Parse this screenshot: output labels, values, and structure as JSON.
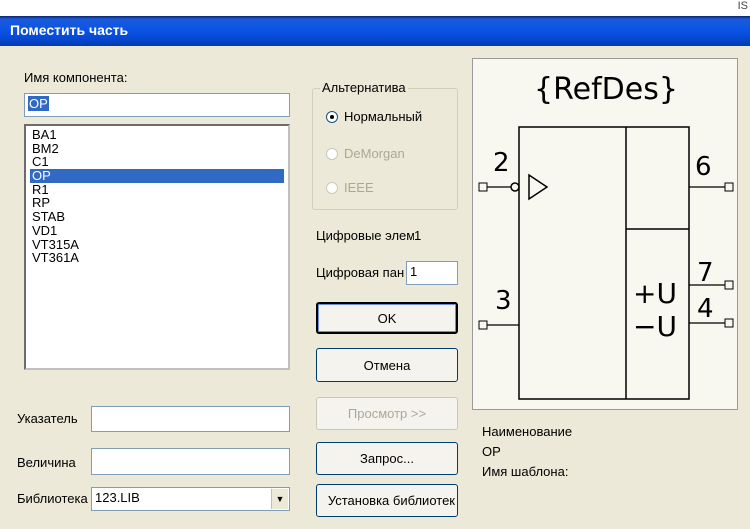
{
  "window": {
    "title": "Поместить часть",
    "top_right_text": "IS"
  },
  "component": {
    "label": "Имя компонента:",
    "value": "OP",
    "items": [
      "BA1",
      "BM2",
      "C1",
      "OP",
      "R1",
      "RP",
      "STAB",
      "VD1",
      "VT315A",
      "VT361A"
    ],
    "selected_index": 3
  },
  "alternative": {
    "title": "Альтернатива",
    "options": [
      "Нормальный",
      "DeMorgan",
      "IEEE"
    ],
    "selected": "Нормальный"
  },
  "digital": {
    "elements_label": "Цифровые элементы:",
    "elements_value": "1",
    "panel_label": "Цифровая панель:",
    "panel_value": "1"
  },
  "buttons": {
    "ok": "OK",
    "cancel": "Отмена",
    "preview": "Просмотр >>",
    "query": "Запрос...",
    "install": "Установка библиотек"
  },
  "fields": {
    "designator_label": "Указатель",
    "designator_value": "",
    "value_label": "Величина",
    "value_value": "",
    "library_label": "Библиотека",
    "library_value": "123.LIB"
  },
  "symbol": {
    "refdes": "{RefDes}",
    "pin_2": "2",
    "pin_3": "3",
    "pin_6": "6",
    "pin_7": "7",
    "pin_4": "4",
    "plus_u": "+U",
    "minus_u": "−U"
  },
  "info": {
    "name_label": "Наименование",
    "name_value": "OP",
    "template_label": "Имя шаблона:"
  },
  "colors": {
    "selection": "#316ac5",
    "titlebar": "#0b55e6",
    "dialog_bg": "#ece9d8"
  }
}
